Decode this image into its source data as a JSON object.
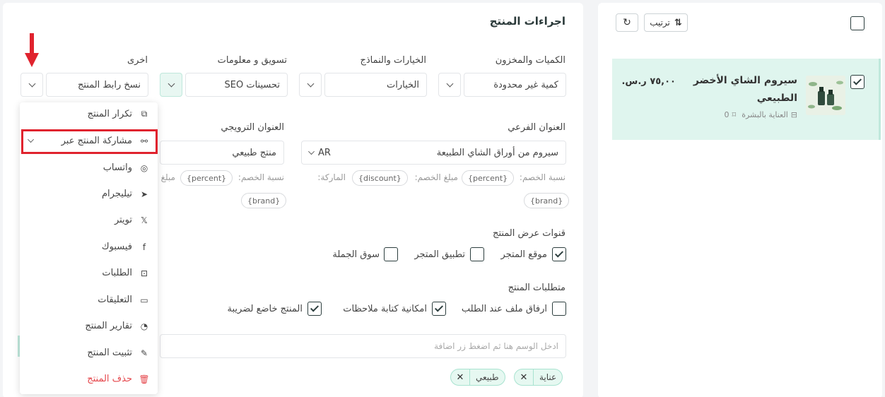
{
  "panel": {
    "title": "اجراءات المنتج"
  },
  "row1": {
    "labels": {
      "quantities": "الكميات والمخزون",
      "options": "الخيارات والنماذج",
      "marketing": "تسويق و معلومات",
      "other": "اخرى"
    },
    "values": {
      "quantities": "كمية غير محدودة",
      "options": "الخيارات",
      "marketing": "تحسينات SEO",
      "other": "نسخ رابط المنتج"
    }
  },
  "row2": {
    "subtitle_label": "العنوان الفرعي",
    "subtitle_value": "سيروم من أوراق الشاي الطبيعة",
    "subtitle_lang": "AR",
    "promo_label": "العنوان الترويجي",
    "promo_value": "منتج طبيعي",
    "vars_a": {
      "discount_pct_label": "نسبة الخصم:",
      "percent_chip": "{percent}",
      "discount_amt_label": "مبلغ الخصم:",
      "discount_chip": "{discount}",
      "brand_label": "الماركة:",
      "brand_chip": "{brand}"
    },
    "vars_b": {
      "discount_pct_label": "نسبة الخصم:",
      "percent_chip": "{percent}",
      "discount_amt_label": "مبلغ",
      "brand_chip": "{brand}"
    }
  },
  "channels": {
    "label": "قنوات عرض المنتج",
    "items": [
      {
        "label": "موقع المتجر",
        "checked": true
      },
      {
        "label": "تطبيق المتجر",
        "checked": false
      },
      {
        "label": "سوق الجملة",
        "checked": false
      }
    ]
  },
  "requirements": {
    "label": "متطلبات المنتج",
    "items": [
      {
        "label": "ارفاق ملف عند الطلب",
        "checked": false
      },
      {
        "label": "امكانية كتابة ملاحظات",
        "checked": true
      },
      {
        "label": "المنتج خاضع لضريبة",
        "checked": true
      }
    ]
  },
  "tags_input": {
    "placeholder": "ادخل الوسم هنا ثم اضغط زر اضافة",
    "tags": [
      "عناية",
      "طبيعي"
    ],
    "remove_glyph": "✕"
  },
  "dropdown": {
    "items": [
      {
        "label": "تكرار المنتج",
        "icon": "copy-icon",
        "glyph": "⧉"
      },
      {
        "label": "مشاركة المنتج عبر",
        "icon": "share-icon",
        "glyph": "⚯"
      },
      {
        "label": "واتساب",
        "icon": "whatsapp-icon",
        "glyph": "◎"
      },
      {
        "label": "تيليجرام",
        "icon": "telegram-icon",
        "glyph": "➤"
      },
      {
        "label": "تويتر",
        "icon": "x-twitter-icon",
        "glyph": "𝕏"
      },
      {
        "label": "فيسبوك",
        "icon": "facebook-icon",
        "glyph": "f"
      },
      {
        "label": "الطلبات",
        "icon": "bag-icon",
        "glyph": "⊡"
      },
      {
        "label": "التعليقات",
        "icon": "comment-icon",
        "glyph": "▭"
      },
      {
        "label": "تقارير المنتج",
        "icon": "report-icon",
        "glyph": "◔"
      },
      {
        "label": "تثبيت المنتج",
        "icon": "pin-icon",
        "glyph": "✎"
      },
      {
        "label": "حذف المنتج",
        "icon": "trash-icon",
        "glyph": "🗑"
      }
    ]
  },
  "sidebar": {
    "sort_label": "ترتيب",
    "product": {
      "name_line1": "سيروم الشاي الأخضر",
      "name_line2": "الطبيعي",
      "price": "٧٥,٠٠ ر.س.",
      "category": "العناية بالبشرة",
      "tag_count": "0"
    }
  },
  "colors": {
    "accent_bg": "#e6f8f1",
    "highlight": "#e0232e",
    "danger": "#e5484d",
    "selected_row": "#dff5ee"
  }
}
